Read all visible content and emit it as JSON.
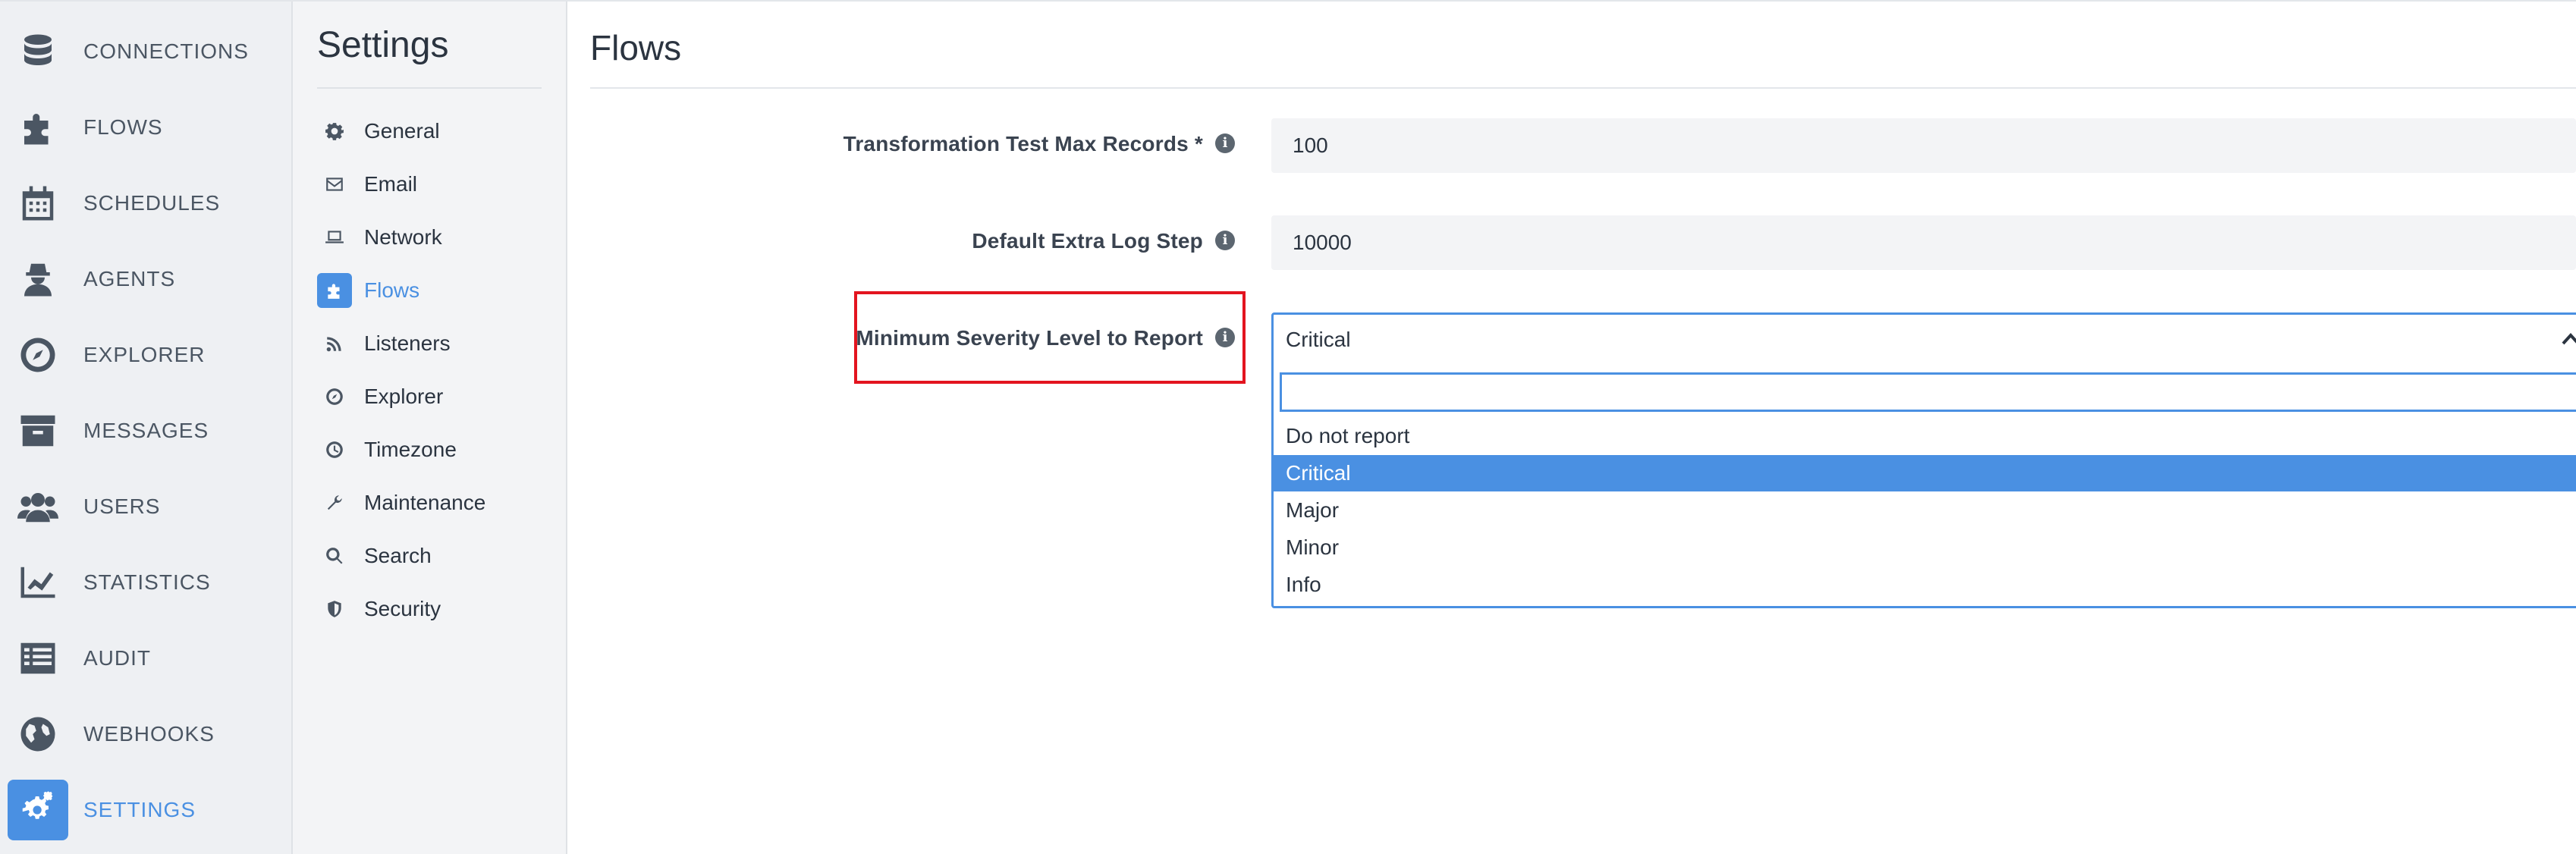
{
  "main_nav": {
    "items": [
      {
        "label": "CONNECTIONS",
        "icon": "database-icon"
      },
      {
        "label": "FLOWS",
        "icon": "puzzle-icon"
      },
      {
        "label": "SCHEDULES",
        "icon": "calendar-icon"
      },
      {
        "label": "AGENTS",
        "icon": "agent-icon"
      },
      {
        "label": "EXPLORER",
        "icon": "compass-icon"
      },
      {
        "label": "MESSAGES",
        "icon": "archive-icon"
      },
      {
        "label": "USERS",
        "icon": "users-icon"
      },
      {
        "label": "STATISTICS",
        "icon": "chart-line-icon"
      },
      {
        "label": "AUDIT",
        "icon": "list-icon"
      },
      {
        "label": "WEBHOOKS",
        "icon": "globe-icon"
      },
      {
        "label": "SETTINGS",
        "icon": "cogs-icon",
        "active": true
      }
    ]
  },
  "settings_nav": {
    "title": "Settings",
    "items": [
      {
        "label": "General",
        "icon": "gear-icon"
      },
      {
        "label": "Email",
        "icon": "envelope-icon"
      },
      {
        "label": "Network",
        "icon": "laptop-icon"
      },
      {
        "label": "Flows",
        "icon": "puzzle-icon",
        "active": true
      },
      {
        "label": "Listeners",
        "icon": "rss-icon"
      },
      {
        "label": "Explorer",
        "icon": "compass-icon"
      },
      {
        "label": "Timezone",
        "icon": "clock-icon"
      },
      {
        "label": "Maintenance",
        "icon": "wrench-icon"
      },
      {
        "label": "Search",
        "icon": "search-icon"
      },
      {
        "label": "Security",
        "icon": "shield-icon"
      }
    ]
  },
  "main": {
    "title": "Flows",
    "fields": {
      "max_records": {
        "label": "Transformation Test Max Records *",
        "value": "100"
      },
      "extra_log_step": {
        "label": "Default Extra Log Step",
        "value": "10000"
      },
      "severity": {
        "label": "Minimum Severity Level to Report",
        "selected": "Critical",
        "search_placeholder": "",
        "options": [
          "Do not report",
          "Critical",
          "Major",
          "Minor",
          "Info"
        ]
      }
    }
  },
  "colors": {
    "accent": "#4a90e2",
    "highlight": "#e3141f",
    "nav_bg": "#eef0f3"
  }
}
